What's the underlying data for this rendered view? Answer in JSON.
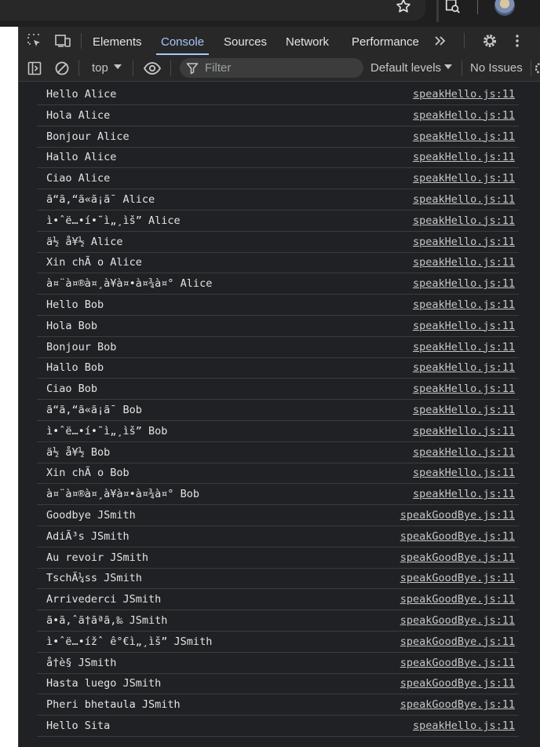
{
  "devtools": {
    "tabs": [
      "Elements",
      "Console",
      "Sources",
      "Network",
      "Performance"
    ],
    "active_tab": "Console",
    "more_tabs_label": "»"
  },
  "toolbar": {
    "context": "top",
    "filter_placeholder": "Filter",
    "levels": "Default levels",
    "issues": "No Issues"
  },
  "console": {
    "rows": [
      {
        "message": "Hello Alice",
        "source": "speakHello.js:11"
      },
      {
        "message": "Hola Alice",
        "source": "speakHello.js:11"
      },
      {
        "message": "Bonjour Alice",
        "source": "speakHello.js:11"
      },
      {
        "message": "Hallo Alice",
        "source": "speakHello.js:11"
      },
      {
        "message": "Ciao Alice",
        "source": "speakHello.js:11"
      },
      {
        "message": "ã“ã‚“ã«ã¡ã¯ Alice",
        "source": "speakHello.js:11"
      },
      {
        "message": "ì•ˆë…•í•˜ì„¸ìš” Alice",
        "source": "speakHello.js:11"
      },
      {
        "message": "ä½ å¥½ Alice",
        "source": "speakHello.js:11"
      },
      {
        "message": "Xin chÃ o Alice",
        "source": "speakHello.js:11"
      },
      {
        "message": "à¤¨à¤®à¤¸à¥à¤•à¤¾à¤° Alice",
        "source": "speakHello.js:11"
      },
      {
        "message": "Hello Bob",
        "source": "speakHello.js:11"
      },
      {
        "message": "Hola Bob",
        "source": "speakHello.js:11"
      },
      {
        "message": "Bonjour Bob",
        "source": "speakHello.js:11"
      },
      {
        "message": "Hallo Bob",
        "source": "speakHello.js:11"
      },
      {
        "message": "Ciao Bob",
        "source": "speakHello.js:11"
      },
      {
        "message": "ã“ã‚“ã«ã¡ã¯ Bob",
        "source": "speakHello.js:11"
      },
      {
        "message": "ì•ˆë…•í•˜ì„¸ìš” Bob",
        "source": "speakHello.js:11"
      },
      {
        "message": "ä½ å¥½ Bob",
        "source": "speakHello.js:11"
      },
      {
        "message": "Xin chÃ o Bob",
        "source": "speakHello.js:11"
      },
      {
        "message": "à¤¨à¤®à¤¸à¥à¤•à¤¾à¤° Bob",
        "source": "speakHello.js:11"
      },
      {
        "message": "Goodbye JSmith",
        "source": "speakGoodBye.js:11"
      },
      {
        "message": "AdiÃ³s JSmith",
        "source": "speakGoodBye.js:11"
      },
      {
        "message": "Au revoir JSmith",
        "source": "speakGoodBye.js:11"
      },
      {
        "message": "TschÃ¼ss JSmith",
        "source": "speakGoodBye.js:11"
      },
      {
        "message": "Arrivederci JSmith",
        "source": "speakGoodBye.js:11"
      },
      {
        "message": "ã•ã‚ˆã†ãªã‚‰ JSmith",
        "source": "speakGoodBye.js:11"
      },
      {
        "message": "ì•ˆë…•ížˆ ê°€ì„¸ìš” JSmith",
        "source": "speakGoodBye.js:11"
      },
      {
        "message": "å†è§ JSmith",
        "source": "speakGoodBye.js:11"
      },
      {
        "message": "Hasta luego JSmith",
        "source": "speakGoodBye.js:11"
      },
      {
        "message": "Pheri bhetaula JSmith",
        "source": "speakGoodBye.js:11"
      },
      {
        "message": "Hello Sita",
        "source": "speakHello.js:11"
      }
    ]
  }
}
